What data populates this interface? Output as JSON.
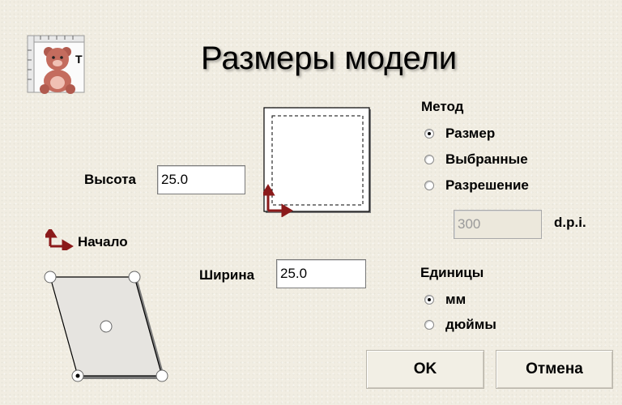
{
  "title": "Размеры модели",
  "height": {
    "label": "Высота",
    "value": "25.0"
  },
  "width": {
    "label": "Ширина",
    "value": "25.0"
  },
  "origin_label": "Начало",
  "method": {
    "heading": "Метод",
    "options": [
      {
        "label": "Размер",
        "selected": true
      },
      {
        "label": "Выбранные",
        "selected": false
      },
      {
        "label": "Разрешение",
        "selected": false
      }
    ],
    "resolution_value": "300",
    "resolution_unit": "d.p.i."
  },
  "units": {
    "heading": "Единицы",
    "options": [
      {
        "label": "мм",
        "selected": true
      },
      {
        "label": "дюймы",
        "selected": false
      }
    ]
  },
  "buttons": {
    "ok": "OK",
    "cancel": "Отмена"
  },
  "icons": {
    "app_logo": "teddy-bear-ruler-icon",
    "origin_arrow": "origin-corner-arrow-icon"
  },
  "colors": {
    "arrow": "#8b1a1a",
    "dialog_bg": "#f1ede2"
  }
}
